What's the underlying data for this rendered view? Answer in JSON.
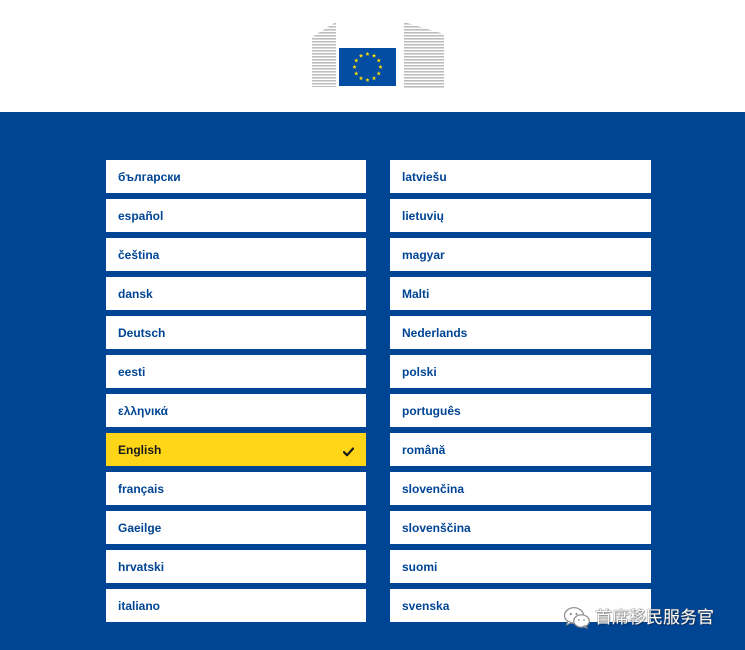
{
  "header": {
    "logo_icon": "european-commission-logo"
  },
  "colors": {
    "header_bg": "#ffffff",
    "page_bg": "#004494",
    "option_bg": "#ffffff",
    "option_text": "#004494",
    "selected_bg": "#FFD617",
    "flag_blue": "#034EA2",
    "flag_star": "#FFDD00",
    "logo_lines": "#bdbdbd"
  },
  "languages": {
    "left": [
      {
        "label": "български"
      },
      {
        "label": "español"
      },
      {
        "label": "čeština"
      },
      {
        "label": "dansk"
      },
      {
        "label": "Deutsch"
      },
      {
        "label": "eesti"
      },
      {
        "label": "ελληνικά"
      },
      {
        "label": "English",
        "selected": true
      },
      {
        "label": "français"
      },
      {
        "label": "Gaeilge"
      },
      {
        "label": "hrvatski"
      },
      {
        "label": "italiano"
      }
    ],
    "right": [
      {
        "label": "latviešu"
      },
      {
        "label": "lietuvių"
      },
      {
        "label": "magyar"
      },
      {
        "label": "Malti"
      },
      {
        "label": "Nederlands"
      },
      {
        "label": "polski"
      },
      {
        "label": "português"
      },
      {
        "label": "română"
      },
      {
        "label": "slovenčina"
      },
      {
        "label": "slovenščina"
      },
      {
        "label": "suomi"
      },
      {
        "label": "svenska"
      }
    ]
  },
  "selected_icon": "check-icon",
  "watermark": {
    "icon": "wechat-icon",
    "text": "首席移民服务官"
  }
}
